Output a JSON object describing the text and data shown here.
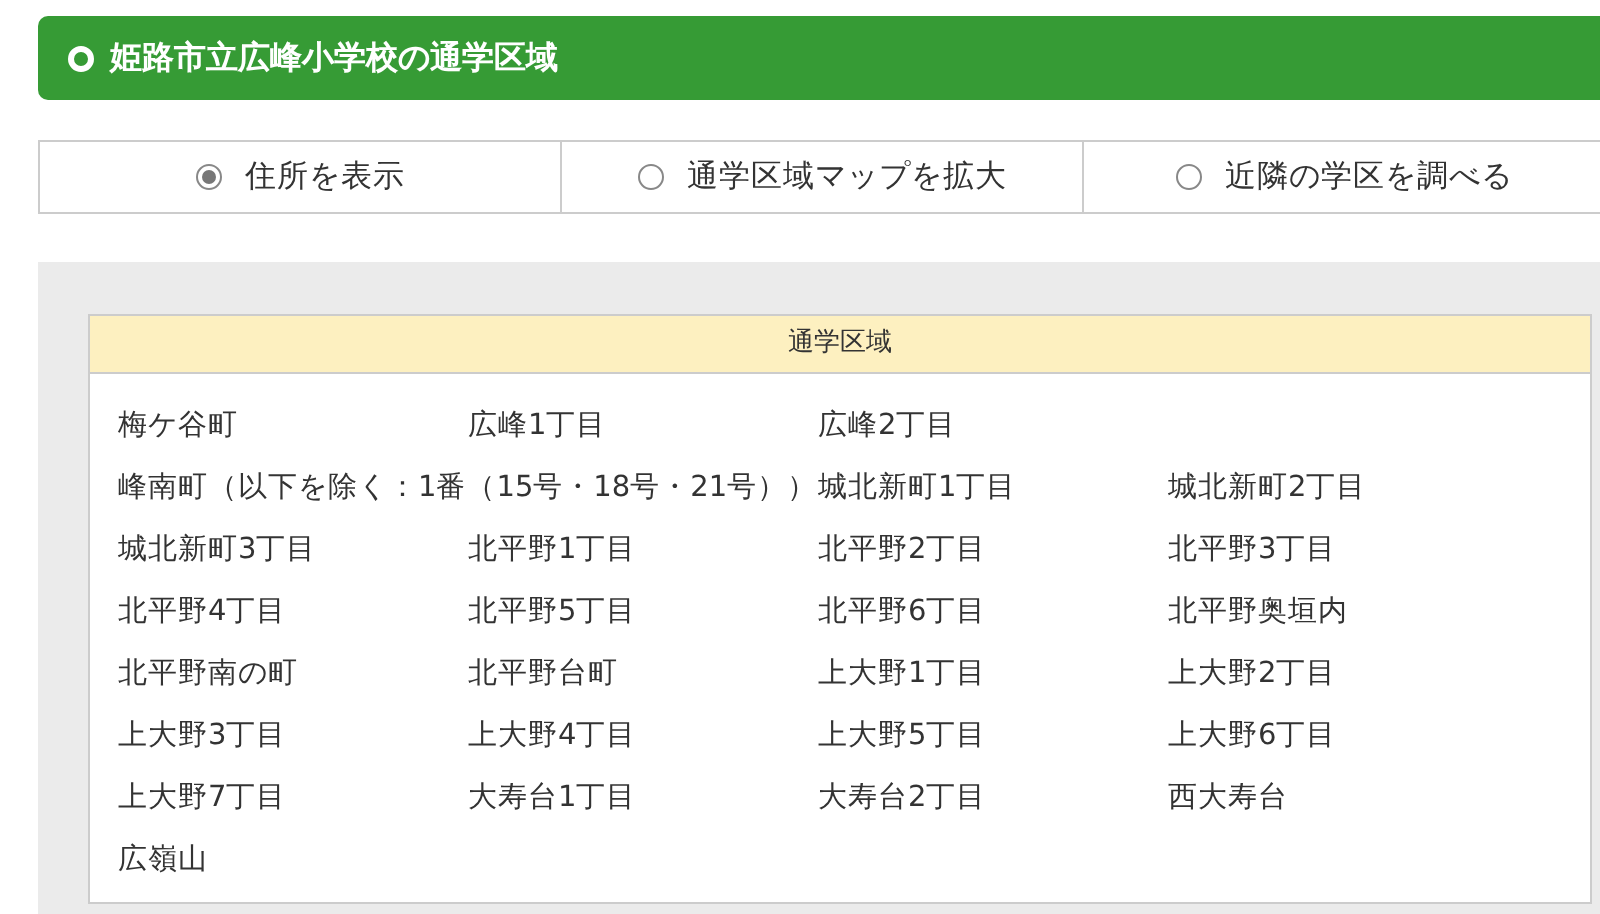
{
  "header": {
    "title": "姫路市立広峰小学校の通学区域"
  },
  "tabs": [
    {
      "label": "住所を表示",
      "selected": true
    },
    {
      "label": "通学区域マップを拡大",
      "selected": false
    },
    {
      "label": "近隣の学区を調べる",
      "selected": false
    }
  ],
  "district": {
    "heading": "通学区域",
    "rows": [
      [
        "梅ケ谷町",
        "広峰1丁目",
        "広峰2丁目"
      ],
      [
        "峰南町（以下を除く：1番（15号・18号・21号））",
        "",
        "城北新町1丁目",
        "城北新町2丁目"
      ],
      [
        "城北新町3丁目",
        "北平野1丁目",
        "北平野2丁目",
        "北平野3丁目"
      ],
      [
        "北平野4丁目",
        "北平野5丁目",
        "北平野6丁目",
        "北平野奥垣内"
      ],
      [
        "北平野南の町",
        "北平野台町",
        "上大野1丁目",
        "上大野2丁目"
      ],
      [
        "上大野3丁目",
        "上大野4丁目",
        "上大野5丁目",
        "上大野6丁目"
      ],
      [
        "上大野7丁目",
        "大寿台1丁目",
        "大寿台2丁目",
        "西大寿台"
      ],
      [
        "広嶺山"
      ]
    ]
  }
}
